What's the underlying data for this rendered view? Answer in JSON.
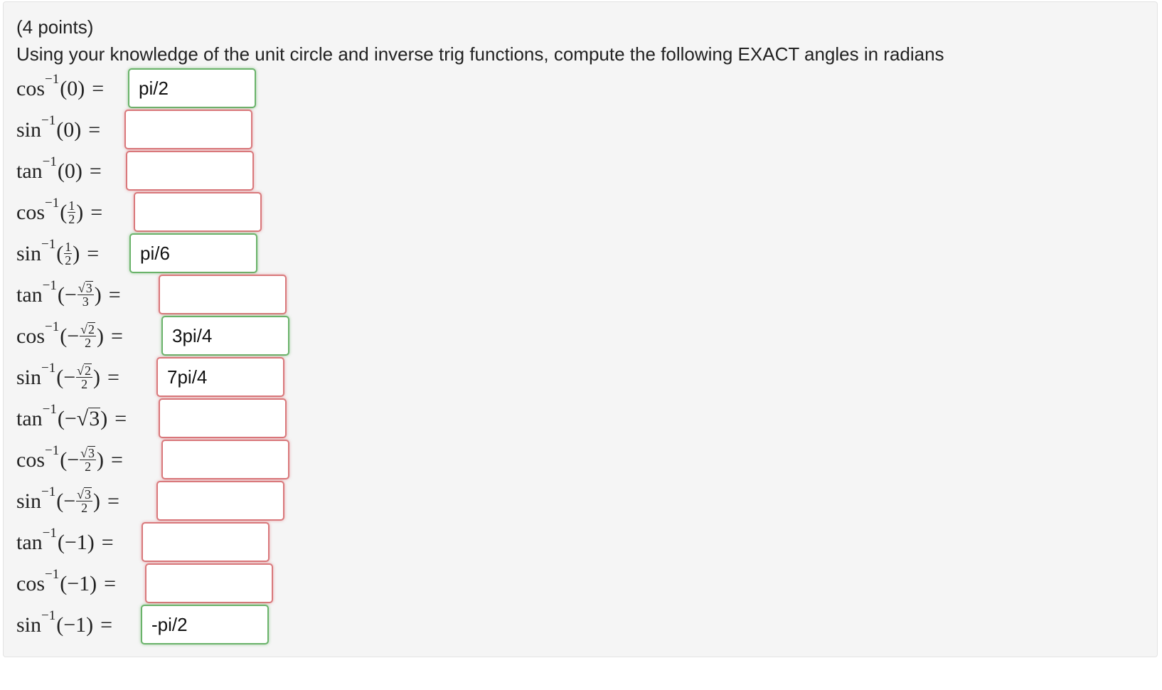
{
  "problem": {
    "points": "(4 points)",
    "instructions": "Using your knowledge of the unit circle and inverse trig functions, compute the following EXACT angles in radians"
  },
  "status_colors": {
    "correct": "#6ab36a",
    "incorrect": "#d9787b"
  },
  "rows": [
    {
      "fn": "cos",
      "sup": "−1",
      "arg": "(0)",
      "eq": "=",
      "answer": "pi/2",
      "status": "correct"
    },
    {
      "fn": "sin",
      "sup": "−1",
      "arg": "(0)",
      "eq": "=",
      "answer": "",
      "status": "incorrect"
    },
    {
      "fn": "tan",
      "sup": "−1",
      "arg": "(0)",
      "eq": "=",
      "answer": "",
      "status": "incorrect"
    },
    {
      "fn": "cos",
      "sup": "−1",
      "open": "(",
      "sign": "",
      "num": "1",
      "den": "2",
      "close": ")",
      "eq": "=",
      "answer": "",
      "status": "incorrect"
    },
    {
      "fn": "sin",
      "sup": "−1",
      "open": "(",
      "sign": "",
      "num": "1",
      "den": "2",
      "close": ")",
      "eq": "=",
      "answer": "pi/6",
      "status": "correct"
    },
    {
      "fn": "tan",
      "sup": "−1",
      "open": "(",
      "sign": "−",
      "num_root": "√",
      "num_rad": "3",
      "den": "3",
      "close": ")",
      "eq": "=",
      "answer": "",
      "status": "incorrect"
    },
    {
      "fn": "cos",
      "sup": "−1",
      "open": "(",
      "sign": "−",
      "num_root": "√",
      "num_rad": "2",
      "den": "2",
      "close": ")",
      "eq": "=",
      "answer": "3pi/4",
      "status": "correct"
    },
    {
      "fn": "sin",
      "sup": "−1",
      "open": "(",
      "sign": "−",
      "num_root": "√",
      "num_rad": "2",
      "den": "2",
      "close": ")",
      "eq": "=",
      "answer": "7pi/4",
      "status": "incorrect"
    },
    {
      "fn": "tan",
      "sup": "−1",
      "open": "(",
      "sign": "−",
      "root": "√",
      "rad": "3",
      "close": ")",
      "eq": "=",
      "answer": "",
      "status": "incorrect"
    },
    {
      "fn": "cos",
      "sup": "−1",
      "open": "(",
      "sign": "−",
      "num_root": "√",
      "num_rad": "3",
      "den": "2",
      "close": ")",
      "eq": "=",
      "answer": "",
      "status": "incorrect"
    },
    {
      "fn": "sin",
      "sup": "−1",
      "open": "(",
      "sign": "−",
      "num_root": "√",
      "num_rad": "3",
      "den": "2",
      "close": ")",
      "eq": "=",
      "answer": "",
      "status": "incorrect",
      "focused": true
    },
    {
      "fn": "tan",
      "sup": "−1",
      "arg": "(−1)",
      "eq": "=",
      "answer": "",
      "status": "incorrect"
    },
    {
      "fn": "cos",
      "sup": "−1",
      "arg": "(−1)",
      "eq": "=",
      "answer": "",
      "status": "incorrect"
    },
    {
      "fn": "sin",
      "sup": "−1",
      "arg": "(−1)",
      "eq": "=",
      "answer": "-pi/2",
      "status": "correct"
    }
  ]
}
